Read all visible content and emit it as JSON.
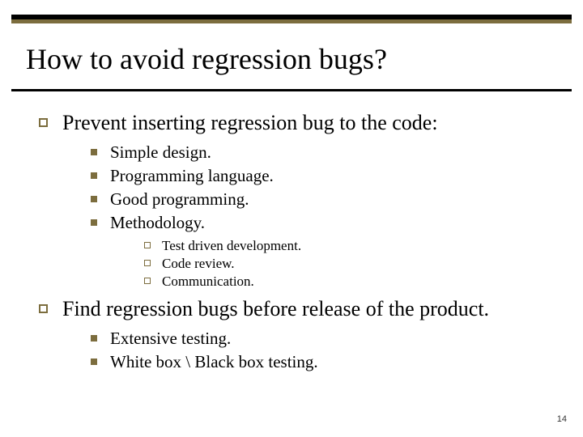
{
  "title": "How to avoid regression bugs?",
  "sections": [
    {
      "text": "Prevent inserting regression bug to the code:",
      "items": [
        {
          "text": "Simple design."
        },
        {
          "text": "Programming language."
        },
        {
          "text": "Good programming."
        },
        {
          "text": "Methodology.",
          "subitems": [
            "Test driven development.",
            "Code review.",
            "Communication."
          ]
        }
      ]
    },
    {
      "text": "Find regression bugs before release of the product.",
      "items": [
        {
          "text": "Extensive testing."
        },
        {
          "text": "White box \\ Black box testing."
        }
      ]
    }
  ],
  "page_number": "14"
}
